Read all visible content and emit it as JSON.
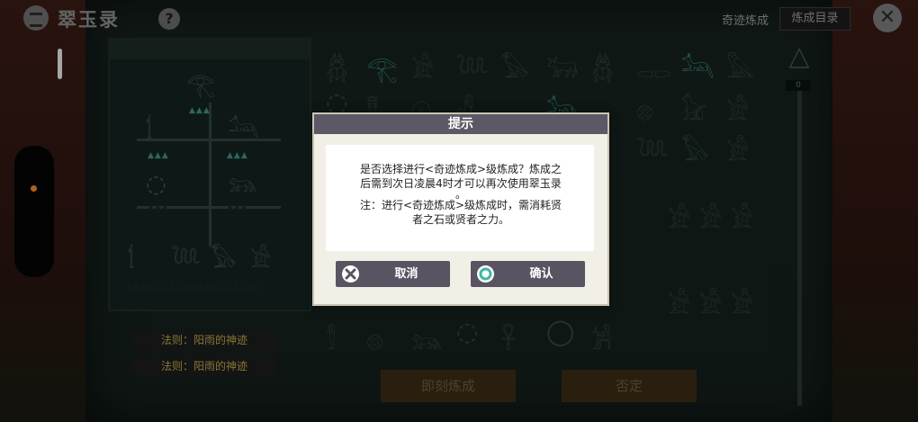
{
  "header": {
    "app_title": "翠玉录",
    "help_icon": "question-icon",
    "craft_type": "奇迹炼成",
    "catalog_button": "炼成目录",
    "close_icon": "close-x-icon"
  },
  "slider": {
    "value": "0"
  },
  "rules": [
    "法则：阳雨的神迹",
    "法则：阳雨的神迹"
  ],
  "actions": {
    "instant": "即刻炼成",
    "deny": "否定"
  },
  "dialog": {
    "title": "提示",
    "line1": "是否选择进行<奇迹炼成>级炼成？炼成之",
    "line2": "后需到次日凌晨4时才可以再次使用翠玉录",
    "line3": "。",
    "line4": "注：进行<奇迹炼成>级炼成时，需消耗贤",
    "line5": "者之石或贤者之力。",
    "cancel_label": "取消",
    "confirm_label": "确认"
  },
  "colors": {
    "dialog_header": "#5d5866",
    "dialog_button": "#5a5462",
    "accent_teal": "#3a8a80"
  }
}
